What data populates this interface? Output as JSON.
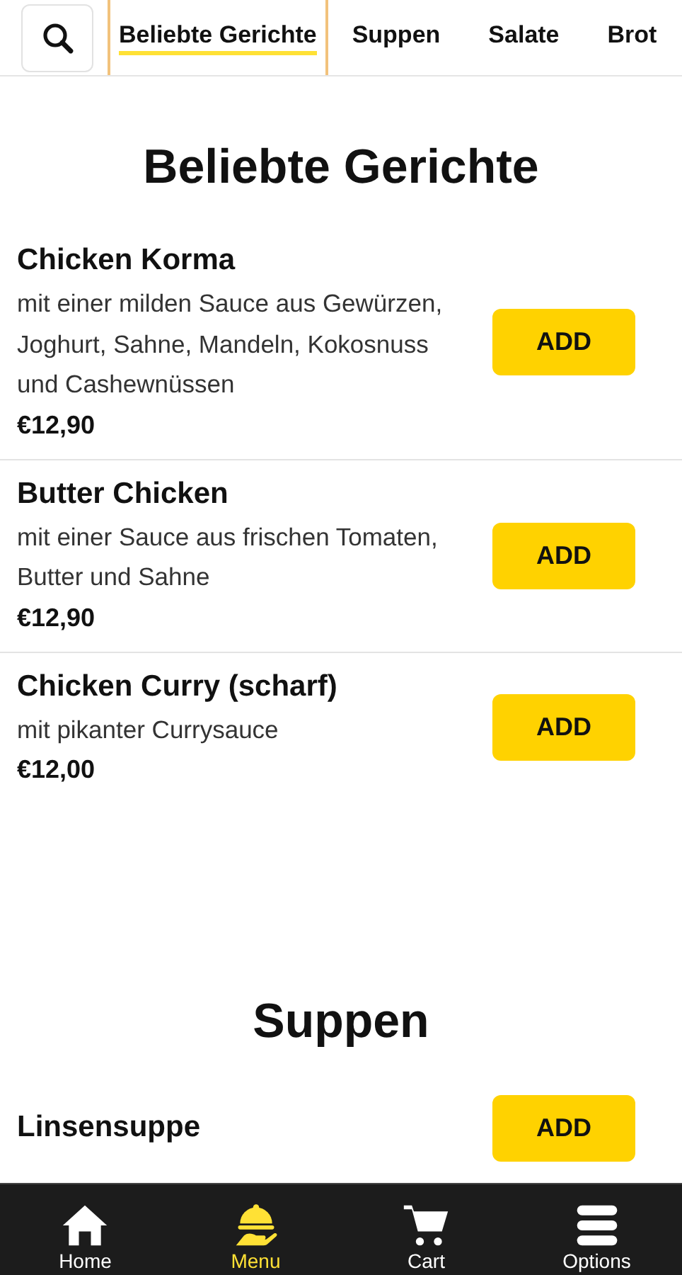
{
  "category_tabs": [
    {
      "label": "Beliebte Gerichte",
      "selected": true
    },
    {
      "label": "Suppen",
      "selected": false
    },
    {
      "label": "Salate",
      "selected": false
    },
    {
      "label": "Brot",
      "selected": false
    }
  ],
  "sections": [
    {
      "title": "Beliebte Gerichte",
      "items": [
        {
          "name": "Chicken Korma",
          "description": "mit einer milden Sauce aus Gewürzen, Joghurt, Sahne, Mandeln, Kokosnuss und Cashewnüssen",
          "price": "€12,90",
          "button": "ADD"
        },
        {
          "name": "Butter Chicken",
          "description": "mit einer Sauce aus frischen Tomaten, Butter und Sahne",
          "price": "€12,90",
          "button": "ADD"
        },
        {
          "name": "Chicken Curry (scharf)",
          "description": "mit pikanter Currysauce",
          "price": "€12,00",
          "button": "ADD"
        }
      ]
    },
    {
      "title": "Suppen",
      "items": [
        {
          "name": "Linsensuppe",
          "button": "ADD"
        }
      ]
    }
  ],
  "bottom_nav": [
    {
      "kind": "home",
      "label": "Home",
      "selected": false
    },
    {
      "kind": "menu",
      "label": "Menu",
      "selected": true
    },
    {
      "kind": "cart",
      "label": "Cart",
      "selected": false
    },
    {
      "kind": "options",
      "label": "Options",
      "selected": false
    }
  ]
}
